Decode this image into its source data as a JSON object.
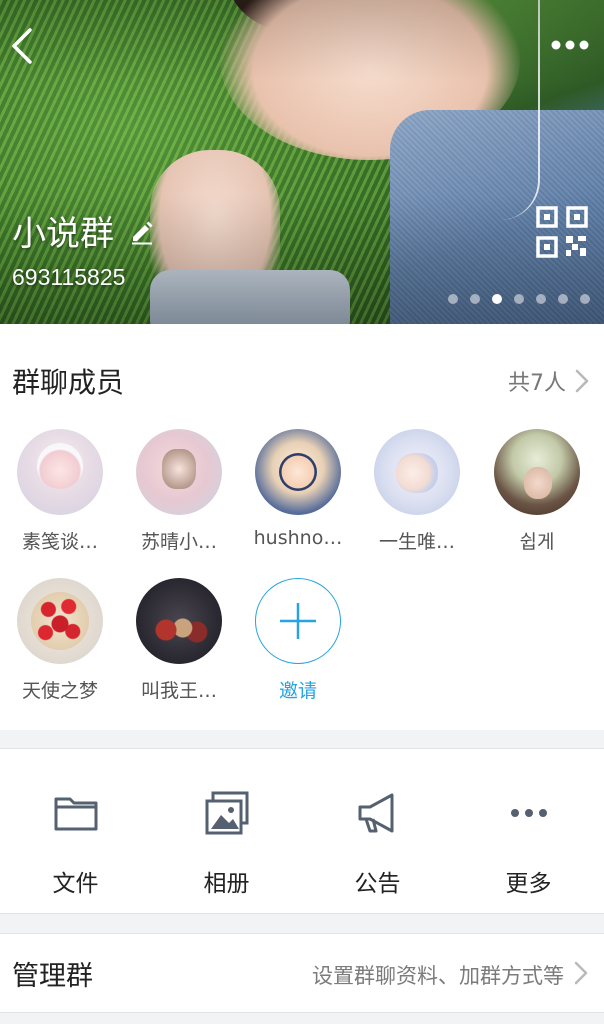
{
  "header": {
    "group_name": "小说群",
    "group_id": "693115825",
    "carousel": {
      "count": 7,
      "active_index": 2
    }
  },
  "members": {
    "title": "群聊成员",
    "count_label": "共7人",
    "items": [
      {
        "name": "素笺谈…"
      },
      {
        "name": "苏晴小…"
      },
      {
        "name": "hushno…"
      },
      {
        "name": "一生唯…"
      },
      {
        "name": "쉽게"
      },
      {
        "name": "天使之梦"
      },
      {
        "name": "叫我王…"
      }
    ],
    "invite_label": "邀请"
  },
  "actions": [
    {
      "label": "文件",
      "icon": "folder-icon"
    },
    {
      "label": "相册",
      "icon": "photo-album-icon"
    },
    {
      "label": "公告",
      "icon": "megaphone-icon"
    },
    {
      "label": "更多",
      "icon": "more-dots-icon"
    }
  ],
  "manage": {
    "title": "管理群",
    "description": "设置群聊资料、加群方式等"
  },
  "colors": {
    "accent": "#27a3e0",
    "icon_gray": "#556070",
    "page_bg": "#f2f3f5"
  }
}
